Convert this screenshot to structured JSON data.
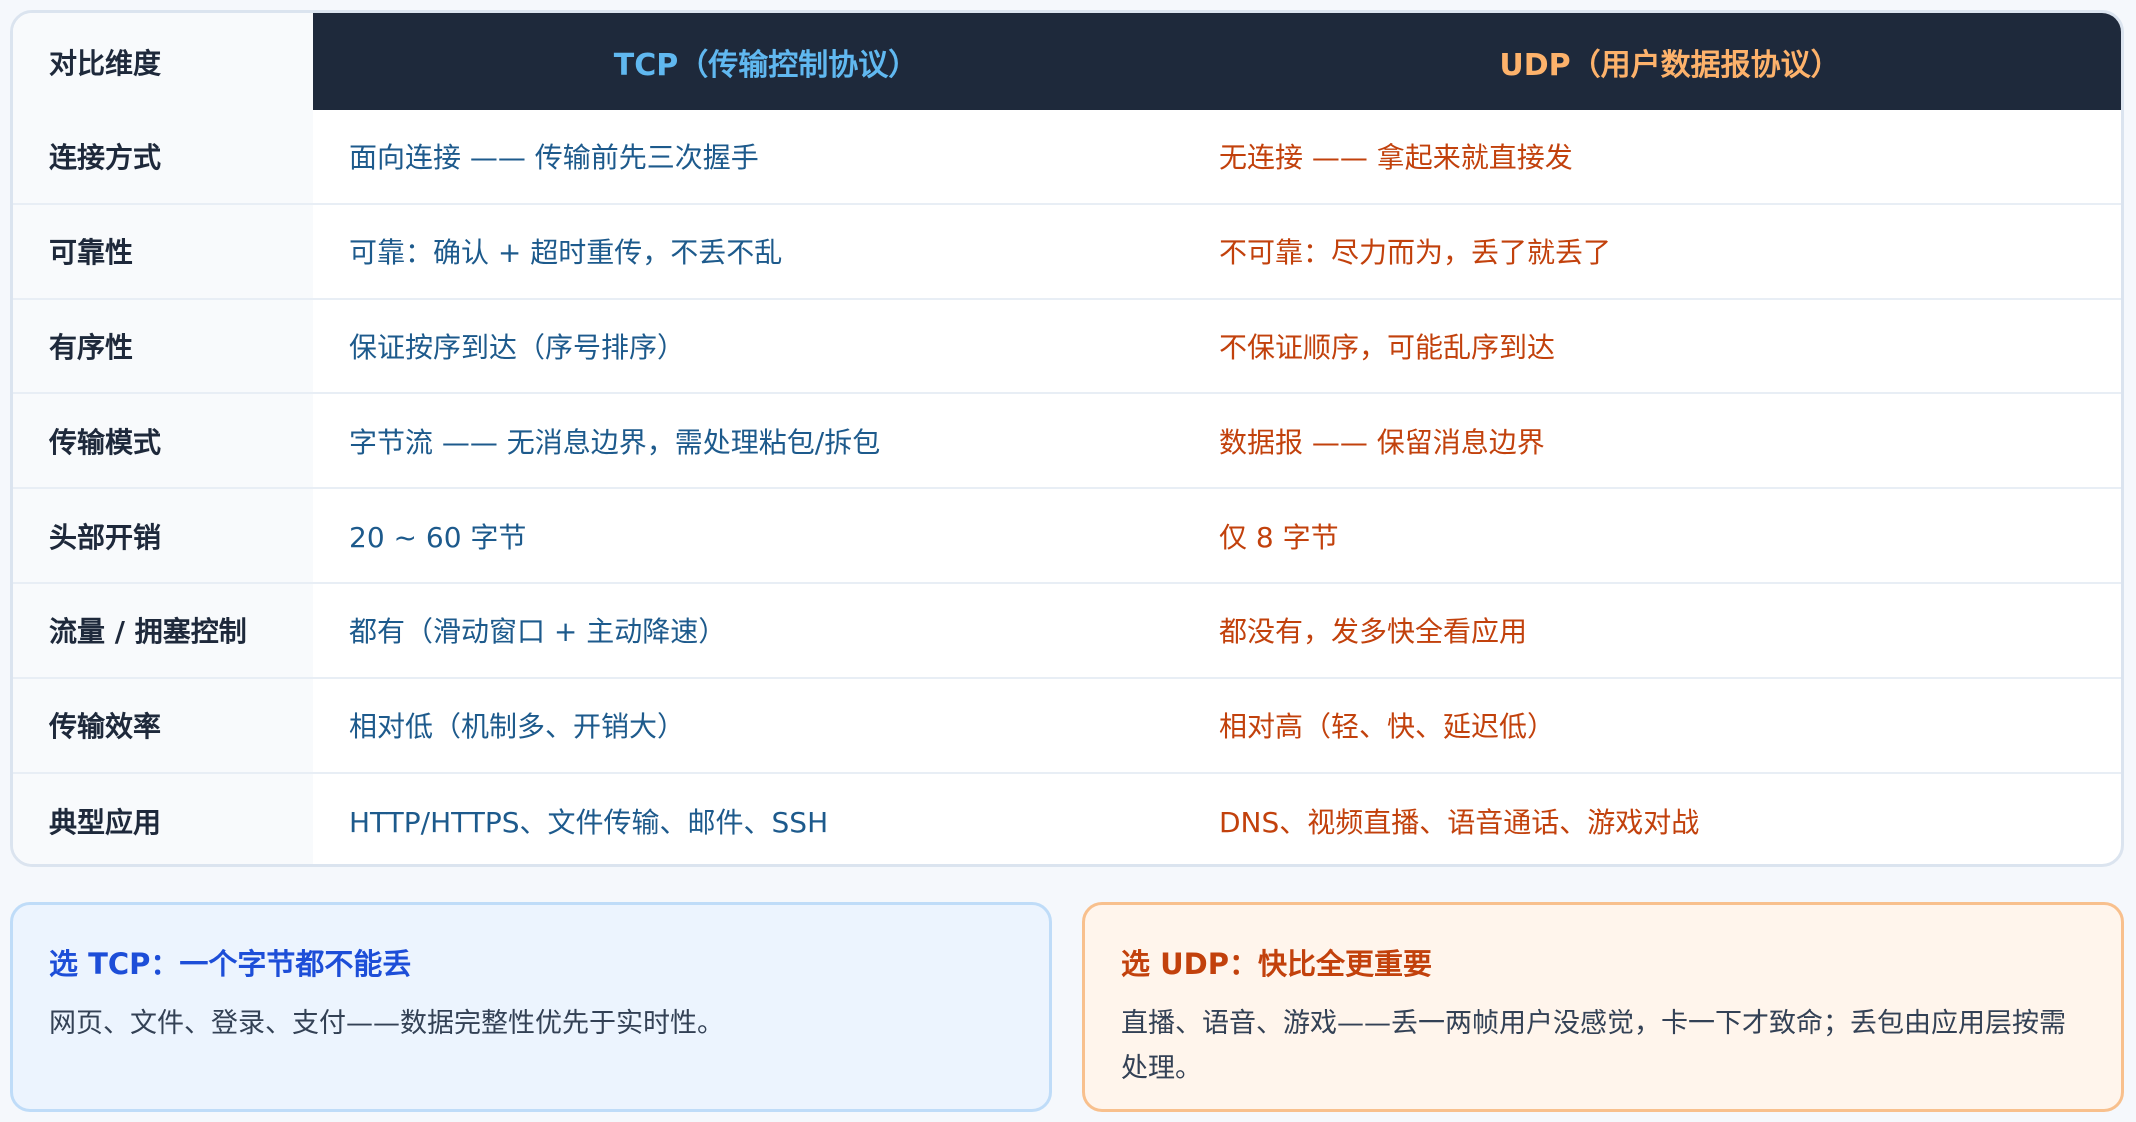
{
  "table": {
    "header": {
      "dimension": "对比维度",
      "tcp": "TCP（传输控制协议）",
      "udp": "UDP（用户数据报协议）"
    },
    "rows": [
      {
        "dimension": "连接方式",
        "tcp": "面向连接 —— 传输前先三次握手",
        "udp": "无连接 —— 拿起来就直接发"
      },
      {
        "dimension": "可靠性",
        "tcp": "可靠：确认 + 超时重传，不丢不乱",
        "udp": "不可靠：尽力而为，丢了就丢了"
      },
      {
        "dimension": "有序性",
        "tcp": "保证按序到达（序号排序）",
        "udp": "不保证顺序，可能乱序到达"
      },
      {
        "dimension": "传输模式",
        "tcp": "字节流 —— 无消息边界，需处理粘包/拆包",
        "udp": "数据报 —— 保留消息边界"
      },
      {
        "dimension": "头部开销",
        "tcp": "20 ~ 60 字节",
        "udp": "仅 8 字节"
      },
      {
        "dimension": "流量 / 拥塞控制",
        "tcp": "都有（滑动窗口 + 主动降速）",
        "udp": "都没有，发多快全看应用"
      },
      {
        "dimension": "传输效率",
        "tcp": "相对低（机制多、开销大）",
        "udp": "相对高（轻、快、延迟低）"
      },
      {
        "dimension": "典型应用",
        "tcp": "HTTP/HTTPS、文件传输、邮件、SSH",
        "udp": "DNS、视频直播、语音通话、游戏对战"
      }
    ]
  },
  "notes": {
    "tcp": {
      "title": "选 TCP：一个字节都不能丢",
      "body": "网页、文件、登录、支付——数据完整性优先于实时性。"
    },
    "udp": {
      "title": "选 UDP：快比全更重要",
      "body": "直播、语音、游戏——丢一两帧用户没感觉，卡一下才致命；丢包由应用层按需处理。"
    }
  },
  "colors": {
    "header_bg": "#1e293b",
    "tcp_accent": "#60b8f0",
    "udp_accent": "#fdb26b",
    "tcp_text": "#1d5a8c",
    "udp_text": "#c2410c"
  }
}
